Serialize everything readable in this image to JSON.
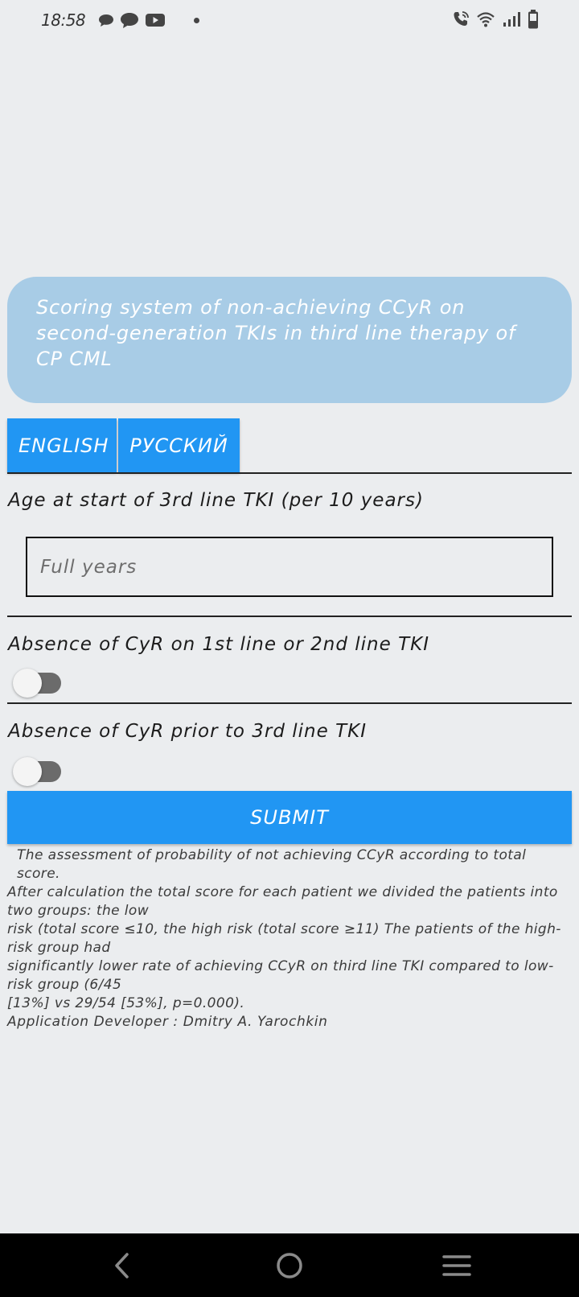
{
  "status_bar": {
    "time": "18:58",
    "left_icons": [
      "chat-bubble-icon",
      "message-icon",
      "youtube-icon",
      "notification-dot-icon"
    ],
    "right_icons": [
      "wifi-calling-icon",
      "wifi-icon",
      "signal-icon",
      "battery-icon"
    ]
  },
  "header": {
    "title": "Scoring system of non-achieving CCyR on second-generation TKIs in third line therapy of CP CML"
  },
  "language_buttons": {
    "english": "ENGLISH",
    "russian": "РУССКИЙ"
  },
  "form": {
    "age_label": "Age at start of 3rd line TKI (per 10 years)",
    "age_placeholder": "Full years",
    "age_value": "",
    "cyr_first_second_label": "Absence of CyR on 1st line or 2nd line TKI",
    "cyr_first_second_on": false,
    "cyr_prior_third_label": "Absence of CyR prior to 3rd line TKI",
    "cyr_prior_third_on": false,
    "submit_label": "SUBMIT"
  },
  "info": {
    "line1": "The assessment of probability of not achieving CCyR according to total score.",
    "line2": "After calculation the total score for each patient we divided the patients into two groups: the low",
    "line3": "risk (total score ≤10, the high risk (total score ≥11) The patients of the high-risk group had",
    "line4": "significantly lower rate of achieving CCyR on third line TKI compared to low-risk group (6/45",
    "line5": "[13%] vs 29/54 [53%], p=0.000).",
    "developer": "Application Developer : Dmitry A. Yarochkin"
  },
  "colors": {
    "background": "#ebedef",
    "accent": "#2196f3",
    "title_card": "#a8cce6"
  },
  "nav_bar": {
    "icons": [
      "back-icon",
      "home-icon",
      "menu-icon"
    ]
  }
}
